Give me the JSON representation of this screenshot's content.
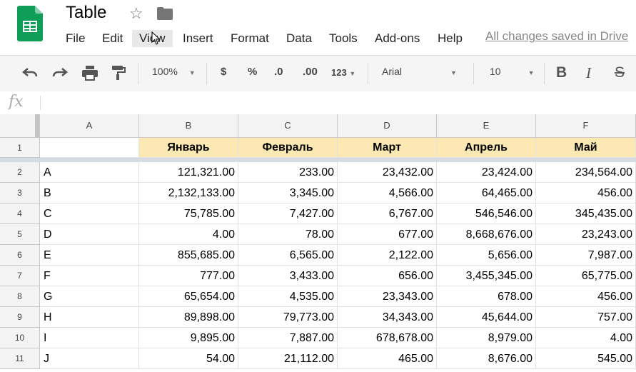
{
  "app": {
    "title": "Table",
    "status": "All changes saved in Drive",
    "menu": [
      "File",
      "Edit",
      "View",
      "Insert",
      "Format",
      "Data",
      "Tools",
      "Add-ons",
      "Help"
    ]
  },
  "toolbar": {
    "zoom": "100%",
    "currency": "$",
    "percent": "%",
    "dec_decrease": ".0",
    "dec_increase": ".00",
    "more_formats": "123",
    "font": "Arial",
    "font_size": "10",
    "bold": "B",
    "italic": "I",
    "strike": "S"
  },
  "formula_bar": {
    "fx": "fx"
  },
  "sheet": {
    "columns": [
      "A",
      "B",
      "C",
      "D",
      "E",
      "F"
    ],
    "header_row": {
      "row": "1",
      "cells": [
        "",
        "Январь",
        "Февраль",
        "Март",
        "Апрель",
        "Май"
      ]
    },
    "rows": [
      {
        "row": "2",
        "cells": [
          "A",
          "121,321.00",
          "233.00",
          "23,432.00",
          "23,424.00",
          "234,564.00"
        ]
      },
      {
        "row": "3",
        "cells": [
          "B",
          "2,132,133.00",
          "3,345.00",
          "4,566.00",
          "64,465.00",
          "456.00"
        ]
      },
      {
        "row": "4",
        "cells": [
          "C",
          "75,785.00",
          "7,427.00",
          "6,767.00",
          "546,546.00",
          "345,435.00"
        ]
      },
      {
        "row": "5",
        "cells": [
          "D",
          "4.00",
          "78.00",
          "677.00",
          "8,668,676.00",
          "23,243.00"
        ]
      },
      {
        "row": "6",
        "cells": [
          "E",
          "855,685.00",
          "6,565.00",
          "2,122.00",
          "5,656.00",
          "7,987.00"
        ]
      },
      {
        "row": "7",
        "cells": [
          "F",
          "777.00",
          "3,433.00",
          "656.00",
          "3,455,345.00",
          "65,775.00"
        ]
      },
      {
        "row": "8",
        "cells": [
          "G",
          "65,654.00",
          "4,535.00",
          "23,343.00",
          "678.00",
          "456.00"
        ]
      },
      {
        "row": "9",
        "cells": [
          "H",
          "89,898.00",
          "79,773.00",
          "34,343.00",
          "45,644.00",
          "757.00"
        ]
      },
      {
        "row": "10",
        "cells": [
          "I",
          "9,895.00",
          "7,887.00",
          "678,678.00",
          "8,979.00",
          "4.00"
        ]
      },
      {
        "row": "11",
        "cells": [
          "J",
          "54.00",
          "21,112.00",
          "465.00",
          "8,676.00",
          "545.00"
        ]
      }
    ]
  },
  "colors": {
    "brand": "#0f9d58",
    "header_fill": "#fce8b2"
  }
}
